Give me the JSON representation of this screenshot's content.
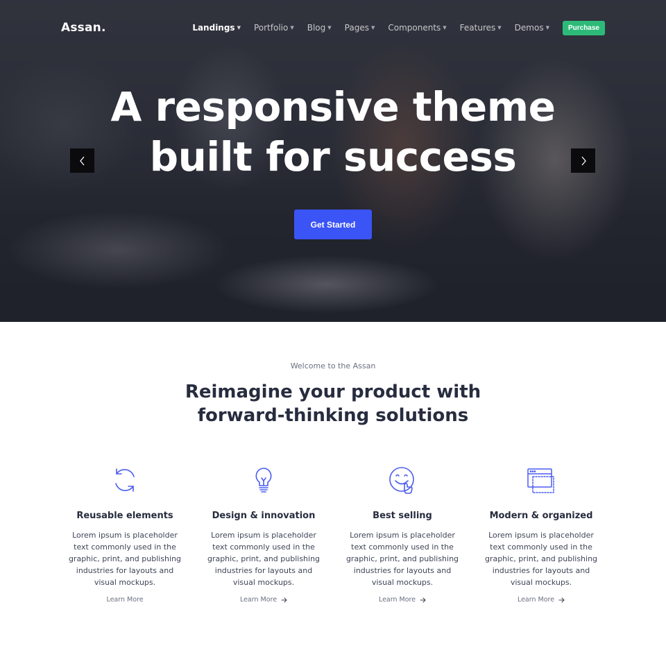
{
  "brand": {
    "name": "Assan."
  },
  "nav": {
    "items": [
      {
        "label": "Landings",
        "active": true
      },
      {
        "label": "Portfolio",
        "active": false
      },
      {
        "label": "Blog",
        "active": false
      },
      {
        "label": "Pages",
        "active": false
      },
      {
        "label": "Components",
        "active": false
      },
      {
        "label": "Features",
        "active": false
      },
      {
        "label": "Demos",
        "active": false
      }
    ],
    "purchase_label": "Purchase"
  },
  "hero": {
    "title_line1": "A responsive theme",
    "title_line2": "built for success",
    "cta_label": "Get Started"
  },
  "intro": {
    "eyebrow": "Welcome to the Assan",
    "title_line1": "Reimagine your product with",
    "title_line2": "forward-thinking solutions"
  },
  "features": [
    {
      "icon": "refresh-icon",
      "title": "Reusable elements",
      "description": "Lorem ipsum is placeholder text commonly used in the graphic, print, and publishing industries for layouts and visual mockups.",
      "link": "Learn More"
    },
    {
      "icon": "lightbulb-icon",
      "title": "Design & innovation",
      "description": "Lorem ipsum is placeholder text commonly used in the graphic, print, and publishing industries for layouts and visual mockups.",
      "link": "Learn More"
    },
    {
      "icon": "smile-icon",
      "title": "Best selling",
      "description": "Lorem ipsum is placeholder text commonly used in the graphic, print, and publishing industries for layouts and visual mockups.",
      "link": "Learn More"
    },
    {
      "icon": "browser-window-icon",
      "title": "Modern & organized",
      "description": "Lorem ipsum is placeholder text commonly used in the graphic, print, and publishing industries for layouts and visual mockups.",
      "link": "Learn More"
    }
  ],
  "colors": {
    "accent_blue": "#3b54f5",
    "purchase_green": "#2dba78",
    "heading_dark": "#272c3f",
    "icon_blue": "#4a5cf0"
  }
}
